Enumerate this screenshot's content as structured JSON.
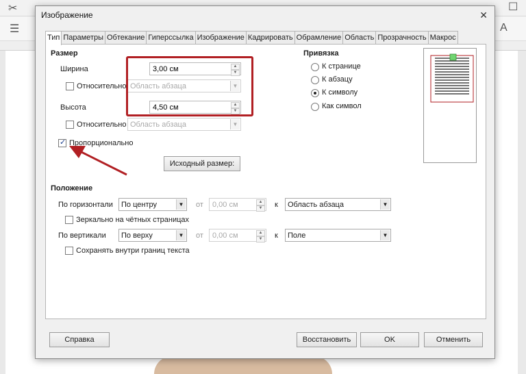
{
  "dialog": {
    "title": "Изображение",
    "close_glyph": "✕"
  },
  "tabs": [
    {
      "label": "Тип"
    },
    {
      "label": "Параметры"
    },
    {
      "label": "Обтекание"
    },
    {
      "label": "Гиперссылка"
    },
    {
      "label": "Изображение"
    },
    {
      "label": "Кадрировать"
    },
    {
      "label": "Обрамление"
    },
    {
      "label": "Область"
    },
    {
      "label": "Прозрачность"
    },
    {
      "label": "Макрос"
    }
  ],
  "size": {
    "section_title": "Размер",
    "width_label": "Ширина",
    "width_value": "3,00 см",
    "relative_label": "Относительно",
    "width_relative_combo": "Область абзаца",
    "height_label": "Высота",
    "height_value": "4,50 см",
    "height_relative_combo": "Область абзаца",
    "proportional_label": "Пропорционально",
    "original_size_button": "Исходный размер:"
  },
  "anchor": {
    "section_title": "Привязка",
    "options": [
      {
        "label": "К странице",
        "checked": false
      },
      {
        "label": "К абзацу",
        "checked": false
      },
      {
        "label": "К символу",
        "checked": true
      },
      {
        "label": "Как символ",
        "checked": false
      }
    ]
  },
  "position": {
    "section_title": "Положение",
    "horizontal_label": "По горизонтали",
    "horizontal_value": "По центру",
    "horizontal_by_label": "от",
    "horizontal_offset": "0,00 см",
    "horizontal_to_label": "к",
    "horizontal_relative": "Область абзаца",
    "mirror_label": "Зеркально на чётных страницах",
    "vertical_label": "По вертикали",
    "vertical_value": "По верху",
    "vertical_by_label": "от",
    "vertical_offset": "0,00 см",
    "vertical_to_label": "к",
    "vertical_relative": "Поле",
    "keep_inside_label": "Сохранять внутри границ текста"
  },
  "buttons": {
    "help": "Справка",
    "reset": "Восстановить",
    "ok": "OK",
    "cancel": "Отменить"
  },
  "colors": {
    "annotation_red": "#b11f23"
  }
}
